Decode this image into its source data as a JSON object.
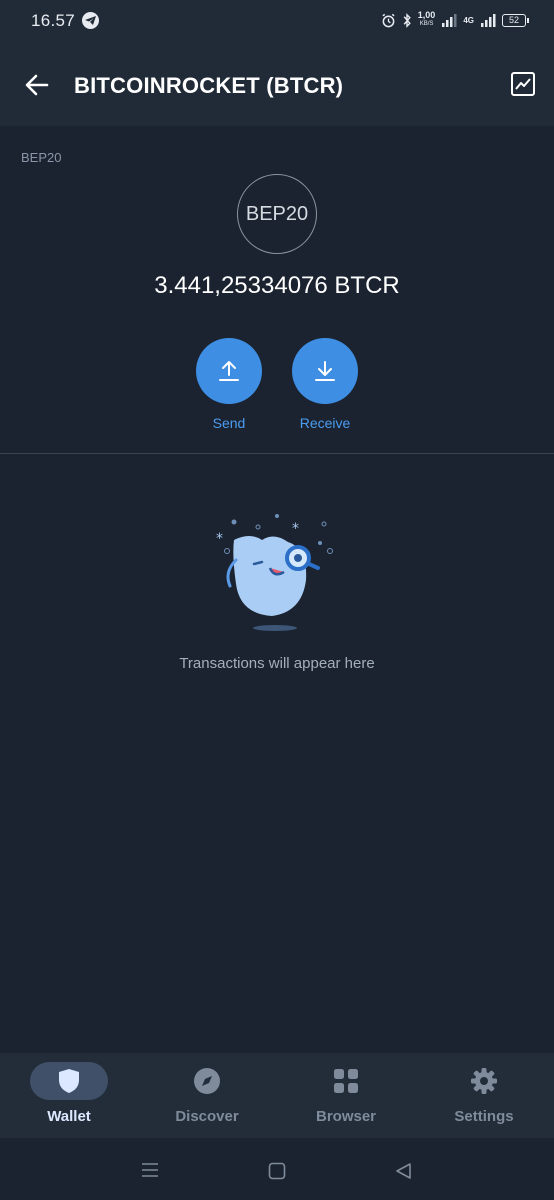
{
  "status_bar": {
    "time": "16.57",
    "speed_value": "1,00",
    "speed_unit": "KB/S",
    "network": "4G",
    "battery": "52"
  },
  "app_bar": {
    "title": "BITCOINROCKET (BTCR)",
    "back_icon": "arrow-left-icon",
    "chart_icon": "line-chart-icon"
  },
  "token": {
    "network_label": "BEP20",
    "logo_text": "BEP20",
    "balance": "3.441,25334076 BTCR"
  },
  "actions": {
    "send_label": "Send",
    "receive_label": "Receive"
  },
  "empty_state": {
    "message": "Transactions will appear here"
  },
  "bottom_nav": {
    "items": [
      {
        "label": "Wallet",
        "icon": "shield-icon",
        "active": true
      },
      {
        "label": "Discover",
        "icon": "compass-icon",
        "active": false
      },
      {
        "label": "Browser",
        "icon": "grid-icon",
        "active": false
      },
      {
        "label": "Settings",
        "icon": "gear-icon",
        "active": false
      }
    ]
  },
  "colors": {
    "background": "#1b2330",
    "header": "#212b38",
    "accent": "#3e8fe4",
    "accent_text": "#4c9cf0",
    "active_nav_pill": "#3f5068"
  }
}
